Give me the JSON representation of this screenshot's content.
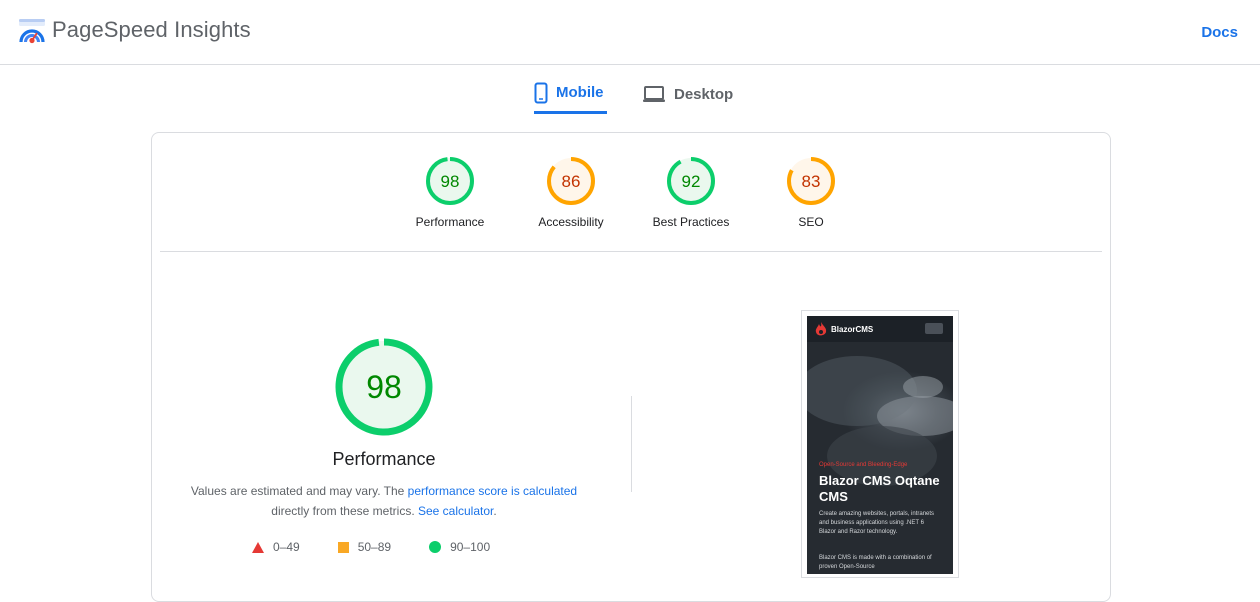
{
  "header": {
    "app_title": "PageSpeed Insights",
    "docs_label": "Docs"
  },
  "tabs": [
    {
      "label": "Mobile",
      "active": true,
      "icon": "smartphone-icon"
    },
    {
      "label": "Desktop",
      "active": false,
      "icon": "laptop-icon"
    }
  ],
  "scores": [
    {
      "label": "Performance",
      "value": 98,
      "value_text": "98",
      "rating": "pass"
    },
    {
      "label": "Accessibility",
      "value": 86,
      "value_text": "86",
      "rating": "average"
    },
    {
      "label": "Best Practices",
      "value": 92,
      "value_text": "92",
      "rating": "pass"
    },
    {
      "label": "SEO",
      "value": 83,
      "value_text": "83",
      "rating": "average"
    }
  ],
  "performance_detail": {
    "title": "Performance",
    "score": 98,
    "score_text": "98",
    "desc_prefix": "Values are estimated and may vary. The ",
    "desc_link1": "performance score is calculated",
    "desc_middle": "directly from these metrics. ",
    "desc_link2": "See calculator",
    "desc_suffix": "."
  },
  "legend": [
    {
      "label": "0–49",
      "shape": "triangle",
      "color": "#e53935"
    },
    {
      "label": "50–89",
      "shape": "square",
      "color": "#f9a825"
    },
    {
      "label": "90–100",
      "shape": "circle",
      "color": "#0cce6b"
    }
  ],
  "screenshot": {
    "brand_name": "BlazorCMS",
    "eyebrow": "Open-Source and Bleeding-Edge",
    "headline": "Blazor CMS Oqtane CMS",
    "blurb": "Create amazing websites, portals, intranets and business applications using .NET 6 Blazor and Razor technology.",
    "blurb2": "Blazor CMS is made with a combination of proven Open-Source"
  },
  "colors": {
    "accent": "#1a73e8",
    "pass": "#0cce6b",
    "pass_text": "#008800",
    "average": "#ffa400",
    "average_text": "#c33300",
    "fail": "#ff4e42"
  }
}
